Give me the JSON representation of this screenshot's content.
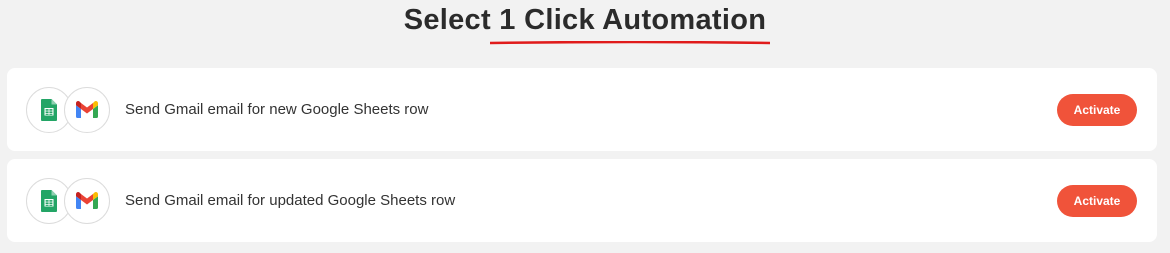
{
  "header": {
    "title": "Select 1 Click Automation",
    "accent_color": "#e01b1b"
  },
  "automations": [
    {
      "description": "Send Gmail email for new Google Sheets row",
      "icons": [
        "google-sheets-icon",
        "gmail-icon"
      ],
      "button_label": "Activate"
    },
    {
      "description": "Send Gmail email for updated Google Sheets row",
      "icons": [
        "google-sheets-icon",
        "gmail-icon"
      ],
      "button_label": "Activate"
    }
  ],
  "colors": {
    "button": "#f0533a",
    "background": "#f2f2f2",
    "card": "#ffffff"
  }
}
